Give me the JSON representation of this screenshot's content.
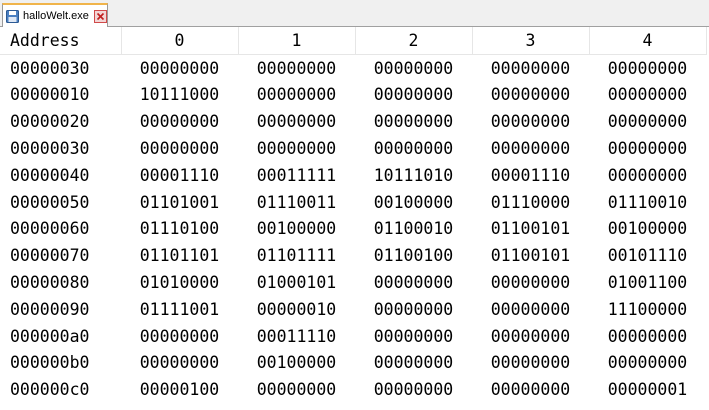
{
  "tab": {
    "label": "halloWelt.exe",
    "icon": "save-disk-icon",
    "close_icon": "close-icon"
  },
  "table": {
    "headers": [
      "Address",
      "0",
      "1",
      "2",
      "3",
      "4"
    ],
    "rows": [
      {
        "address": "00000030",
        "cells": [
          "00000000",
          "00000000",
          "00000000",
          "00000000",
          "00000000"
        ]
      },
      {
        "address": "00000010",
        "cells": [
          "10111000",
          "00000000",
          "00000000",
          "00000000",
          "00000000"
        ]
      },
      {
        "address": "00000020",
        "cells": [
          "00000000",
          "00000000",
          "00000000",
          "00000000",
          "00000000"
        ]
      },
      {
        "address": "00000030",
        "cells": [
          "00000000",
          "00000000",
          "00000000",
          "00000000",
          "00000000"
        ]
      },
      {
        "address": "00000040",
        "cells": [
          "00001110",
          "00011111",
          "10111010",
          "00001110",
          "00000000"
        ]
      },
      {
        "address": "00000050",
        "cells": [
          "01101001",
          "01110011",
          "00100000",
          "01110000",
          "01110010"
        ]
      },
      {
        "address": "00000060",
        "cells": [
          "01110100",
          "00100000",
          "01100010",
          "01100101",
          "00100000"
        ]
      },
      {
        "address": "00000070",
        "cells": [
          "01101101",
          "01101111",
          "01100100",
          "01100101",
          "00101110"
        ]
      },
      {
        "address": "00000080",
        "cells": [
          "01010000",
          "01000101",
          "00000000",
          "00000000",
          "01001100"
        ]
      },
      {
        "address": "00000090",
        "cells": [
          "01111001",
          "00000010",
          "00000000",
          "00000000",
          "11100000"
        ]
      },
      {
        "address": "000000a0",
        "cells": [
          "00000000",
          "00011110",
          "00000000",
          "00000000",
          "00000000"
        ]
      },
      {
        "address": "000000b0",
        "cells": [
          "00000000",
          "00100000",
          "00000000",
          "00000000",
          "00000000"
        ]
      },
      {
        "address": "000000c0",
        "cells": [
          "00000100",
          "00000000",
          "00000000",
          "00000000",
          "00000001"
        ]
      }
    ]
  }
}
